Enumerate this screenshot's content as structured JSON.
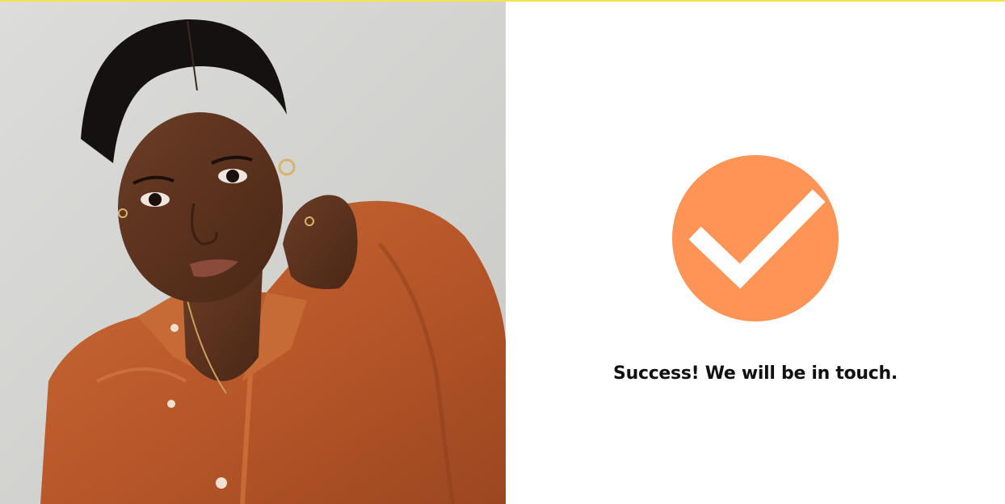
{
  "top_bar": {
    "accent_color": "#f7e34a"
  },
  "hero_image": {
    "icon": "portrait-photo",
    "shirt_color": "#b8582a",
    "background_color": "#d8d8d6"
  },
  "confirmation": {
    "icon": "checkmark-icon",
    "icon_color": "#ff9457",
    "message": "Success! We will be in touch."
  }
}
